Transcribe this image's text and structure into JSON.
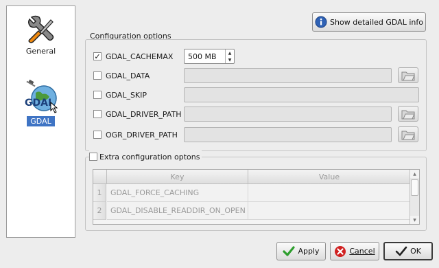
{
  "sidebar": {
    "items": [
      {
        "label": "General",
        "icon": "tools-icon"
      },
      {
        "label": "GDAL",
        "icon": "gdal-globe-icon",
        "icon_text": "GDAL",
        "selected": true
      }
    ]
  },
  "header": {
    "info_button": "Show detailed GDAL info"
  },
  "config": {
    "title": "Configuration options",
    "options": [
      {
        "label": "GDAL_CACHEMAX",
        "checked": true
      },
      {
        "label": "GDAL_DATA",
        "checked": false
      },
      {
        "label": "GDAL_SKIP",
        "checked": false
      },
      {
        "label": "GDAL_DRIVER_PATH",
        "checked": false
      },
      {
        "label": "OGR_DRIVER_PATH",
        "checked": false
      }
    ],
    "cachemax_value": "500 MB"
  },
  "extra": {
    "title": "Extra configuration optons",
    "checked": false,
    "columns": [
      "Key",
      "Value"
    ],
    "rows": [
      {
        "num": "1",
        "key": "GDAL_FORCE_CACHING",
        "value": ""
      },
      {
        "num": "2",
        "key": "GDAL_DISABLE_READDIR_ON_OPEN",
        "value": ""
      }
    ]
  },
  "footer": {
    "apply": "Apply",
    "cancel": "Cancel",
    "ok": "OK"
  },
  "colors": {
    "selection": "#3f74c4",
    "apply_check": "#2e9e2e",
    "cancel_x": "#d02020"
  }
}
